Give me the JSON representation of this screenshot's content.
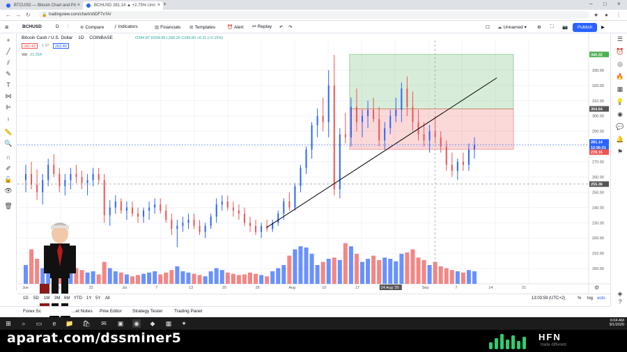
{
  "browser": {
    "tabs": [
      {
        "title": "BTCUSD — Bitcoin Chart and Pri",
        "active": false
      },
      {
        "title": "BCHUSD 281.14 ▲ +2.75% Unn",
        "active": true
      }
    ],
    "url": "tradingview.com/chart/shDF7xYA/"
  },
  "toolbar": {
    "symbol": "BCHUSD",
    "interval": "D",
    "compare": "Compare",
    "indicators": "Indicators",
    "financials": "Financials",
    "templates": "Templates",
    "alert": "Alert",
    "replay": "Replay",
    "layout_name": "Unnamed",
    "publish": "Publish"
  },
  "legend": {
    "title": "Bitcoin Cash / U.S. Dollar",
    "interval": "1D",
    "exchange": "COINBASE",
    "ohlc": "O284.87  H294.85  L282.20  C290.80  +6.11 (+2.15%)",
    "bid": "281.43",
    "spread": "1.97",
    "ask": "282.40",
    "volume_label": "Vol",
    "volume": "21.31K"
  },
  "chart_data": {
    "type": "candlestick",
    "price_axis_labels": [
      "330.00",
      "320.00",
      "310.00",
      "300.00",
      "290.00",
      "280.00",
      "270.00",
      "260.00",
      "250.00",
      "240.00",
      "230.00",
      "220.00",
      "210.00",
      "200.00"
    ],
    "price_markers": [
      {
        "label": "340.32",
        "color": "#4caf50"
      },
      {
        "label": "304.64",
        "color": "#555555"
      },
      {
        "label": "281.14",
        "color": "#2962ff"
      },
      {
        "label": "12:56:01",
        "color": "#2962ff"
      },
      {
        "label": "278.15",
        "color": "#ef5350"
      },
      {
        "label": "255.36",
        "color": "#555555"
      }
    ],
    "time_axis_labels": [
      "Jun",
      "15",
      "22",
      "Jul",
      "7",
      "13",
      "20",
      "26",
      "Aug",
      "10",
      "17",
      "24 Aug '20",
      "Sep",
      "7",
      "14",
      "21"
    ],
    "up_color": "#2962ff",
    "down_color": "#ef5350",
    "position": {
      "target": 340.32,
      "entry": 304.64,
      "stop": 278.15
    },
    "candles": [
      [
        258,
        268,
        250,
        262
      ],
      [
        262,
        270,
        252,
        255
      ],
      [
        255,
        265,
        245,
        250
      ],
      [
        250,
        262,
        242,
        258
      ],
      [
        258,
        272,
        254,
        268
      ],
      [
        268,
        275,
        260,
        262
      ],
      [
        262,
        266,
        250,
        254
      ],
      [
        254,
        262,
        248,
        258
      ],
      [
        258,
        266,
        252,
        262
      ],
      [
        262,
        268,
        256,
        260
      ],
      [
        260,
        264,
        252,
        256
      ],
      [
        256,
        262,
        248,
        258
      ],
      [
        258,
        266,
        254,
        262
      ],
      [
        262,
        266,
        255,
        258
      ],
      [
        258,
        262,
        230,
        235
      ],
      [
        235,
        245,
        228,
        240
      ],
      [
        240,
        248,
        236,
        244
      ],
      [
        244,
        246,
        236,
        238
      ],
      [
        238,
        244,
        232,
        240
      ],
      [
        240,
        244,
        234,
        236
      ],
      [
        236,
        240,
        230,
        234
      ],
      [
        234,
        240,
        230,
        238
      ],
      [
        238,
        244,
        232,
        240
      ],
      [
        240,
        246,
        236,
        242
      ],
      [
        242,
        246,
        236,
        238
      ],
      [
        238,
        242,
        230,
        232
      ],
      [
        232,
        236,
        222,
        226
      ],
      [
        226,
        232,
        214,
        228
      ],
      [
        228,
        234,
        224,
        230
      ],
      [
        230,
        236,
        226,
        232
      ],
      [
        232,
        236,
        226,
        228
      ],
      [
        228,
        232,
        222,
        224
      ],
      [
        224,
        230,
        220,
        228
      ],
      [
        228,
        236,
        226,
        234
      ],
      [
        234,
        246,
        230,
        242
      ],
      [
        242,
        248,
        238,
        244
      ],
      [
        244,
        248,
        238,
        240
      ],
      [
        240,
        244,
        234,
        238
      ],
      [
        238,
        242,
        232,
        236
      ],
      [
        236,
        240,
        228,
        230
      ],
      [
        230,
        234,
        224,
        228
      ],
      [
        228,
        232,
        222,
        224
      ],
      [
        224,
        230,
        220,
        228
      ],
      [
        228,
        232,
        224,
        226
      ],
      [
        226,
        232,
        224,
        230
      ],
      [
        230,
        238,
        228,
        236
      ],
      [
        236,
        246,
        232,
        244
      ],
      [
        244,
        250,
        238,
        240
      ],
      [
        240,
        256,
        238,
        254
      ],
      [
        254,
        268,
        250,
        266
      ],
      [
        266,
        280,
        262,
        278
      ],
      [
        278,
        296,
        272,
        294
      ],
      [
        294,
        305,
        286,
        300
      ],
      [
        300,
        312,
        290,
        296
      ],
      [
        296,
        330,
        286,
        320
      ],
      [
        320,
        340,
        248,
        252
      ],
      [
        252,
        292,
        246,
        288
      ],
      [
        288,
        302,
        282,
        286
      ],
      [
        286,
        312,
        280,
        306
      ],
      [
        306,
        318,
        290,
        296
      ],
      [
        296,
        304,
        286,
        300
      ],
      [
        300,
        310,
        292,
        304
      ],
      [
        304,
        312,
        296,
        298
      ],
      [
        298,
        306,
        280,
        284
      ],
      [
        284,
        296,
        278,
        292
      ],
      [
        292,
        304,
        288,
        300
      ],
      [
        300,
        312,
        296,
        304
      ],
      [
        304,
        322,
        296,
        318
      ],
      [
        318,
        326,
        300,
        306
      ],
      [
        306,
        316,
        290,
        296
      ],
      [
        296,
        304,
        284,
        288
      ],
      [
        288,
        296,
        280,
        284
      ],
      [
        284,
        294,
        276,
        290
      ],
      [
        290,
        300,
        282,
        286
      ],
      [
        286,
        290,
        276,
        280
      ],
      [
        280,
        284,
        264,
        268
      ],
      [
        268,
        276,
        260,
        264
      ],
      [
        264,
        272,
        258,
        270
      ],
      [
        270,
        276,
        264,
        268
      ],
      [
        268,
        282,
        264,
        278
      ],
      [
        278,
        286,
        272,
        281
      ]
    ],
    "volumes": [
      30,
      55,
      40,
      25,
      35,
      45,
      30,
      20,
      28,
      25,
      22,
      18,
      20,
      15,
      35,
      25,
      20,
      18,
      15,
      12,
      14,
      16,
      18,
      20,
      15,
      18,
      22,
      28,
      20,
      18,
      16,
      14,
      12,
      20,
      25,
      22,
      18,
      16,
      14,
      15,
      18,
      16,
      14,
      12,
      20,
      25,
      30,
      45,
      55,
      60,
      58,
      48,
      30,
      35,
      40,
      42,
      38,
      65,
      60,
      48,
      35,
      40,
      45,
      38,
      42,
      40,
      36,
      48,
      50,
      55,
      42,
      38,
      30,
      35,
      28,
      25,
      22,
      20,
      18,
      22,
      20
    ]
  },
  "bottom_tf": {
    "ranges": [
      "1D",
      "5D",
      "1M",
      "3M",
      "6M",
      "YTD",
      "1Y",
      "5Y",
      "All"
    ],
    "time": "13:03:59 (UTC+2)",
    "percent": "%",
    "log": "log",
    "auto": "auto"
  },
  "panels": [
    "Forex Sc",
    "…et Notes",
    "Pine Editor",
    "Strategy Tester",
    "Trading Panel"
  ],
  "taskbar": {
    "time": "6:04 AM",
    "date": "9/1/2020"
  },
  "branding": {
    "watermark": "aparat.com/dssminer5",
    "logo": "HFN",
    "tagline": "trade different"
  }
}
